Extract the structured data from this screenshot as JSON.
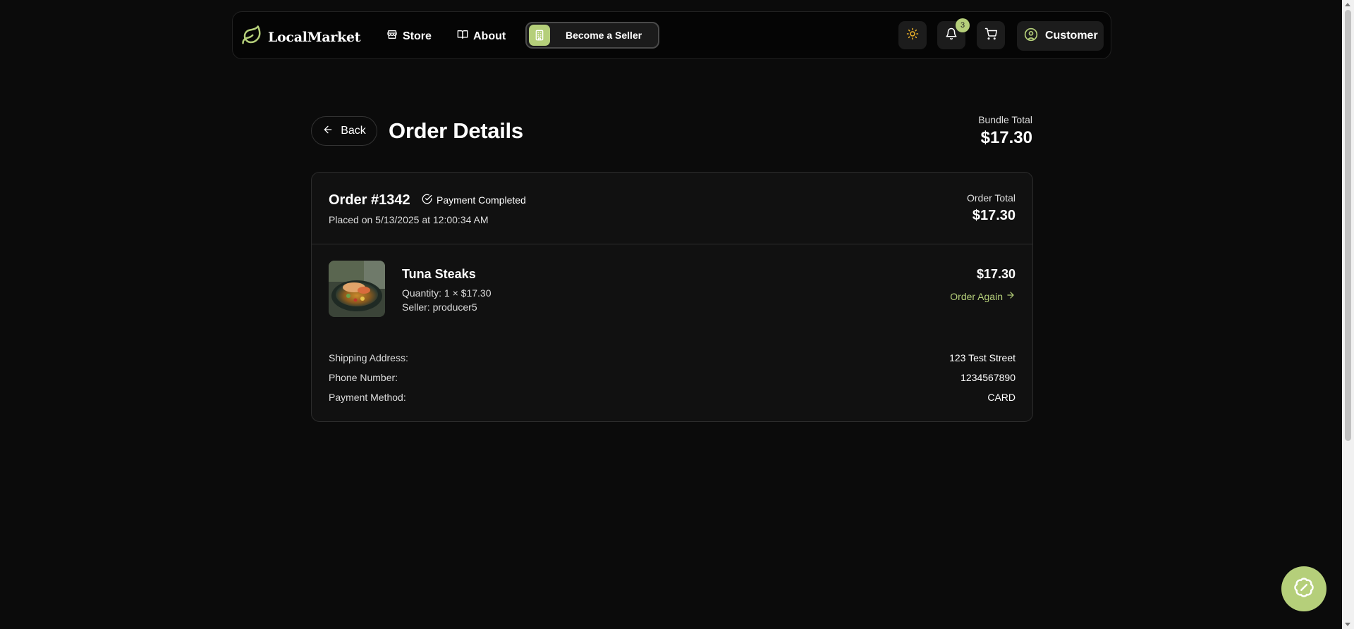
{
  "nav": {
    "brand": "LocalMarket",
    "store": "Store",
    "about": "About",
    "become_seller": "Become a Seller",
    "notifications_count": "3",
    "customer": "Customer"
  },
  "header": {
    "back": "Back",
    "title": "Order Details",
    "bundle_label": "Bundle Total",
    "bundle_value": "$17.30"
  },
  "order": {
    "number": "Order #1342",
    "status": "Payment Completed",
    "placed": "Placed on 5/13/2025 at 12:00:34 AM",
    "total_label": "Order Total",
    "total_value": "$17.30",
    "item": {
      "name": "Tuna Steaks",
      "quantity": "Quantity: 1 × $17.30",
      "seller": "Seller: producer5",
      "price": "$17.30",
      "order_again": "Order Again"
    },
    "info": [
      {
        "label": "Shipping Address:",
        "value": "123 Test Street"
      },
      {
        "label": "Phone Number:",
        "value": "1234567890"
      },
      {
        "label": "Payment Method:",
        "value": "CARD"
      }
    ]
  },
  "colors": {
    "accent": "#b5cf7a",
    "background": "#0b0b0b",
    "card": "#111111"
  },
  "icons": [
    "leaf-icon",
    "store-icon",
    "book-icon",
    "building-icon",
    "sun-icon",
    "bell-icon",
    "cart-icon",
    "user-icon",
    "arrow-left-icon",
    "check-circle-icon",
    "arrow-right-icon",
    "badge-icon"
  ]
}
